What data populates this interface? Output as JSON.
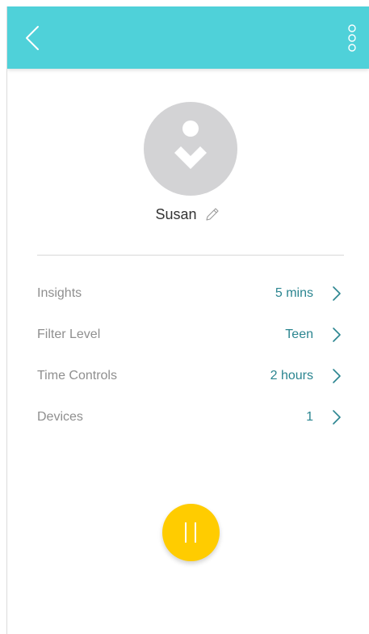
{
  "colors": {
    "header_bg": "#4fd1d9",
    "value_text": "#2b8590",
    "label_text": "#8f8f8f",
    "pause_button": "#ffcc00",
    "avatar_bg": "#d3d3d5"
  },
  "header": {
    "back_icon": "chevron-left-icon",
    "more_icon": "more-vertical-icon"
  },
  "profile": {
    "name": "Susan",
    "avatar_icon": "person-icon",
    "edit_icon": "pencil-icon"
  },
  "settings": [
    {
      "label": "Insights",
      "value": "5 mins"
    },
    {
      "label": "Filter Level",
      "value": "Teen"
    },
    {
      "label": "Time Controls",
      "value": "2 hours"
    },
    {
      "label": "Devices",
      "value": "1"
    }
  ],
  "pause_button": {
    "icon": "pause-icon"
  }
}
